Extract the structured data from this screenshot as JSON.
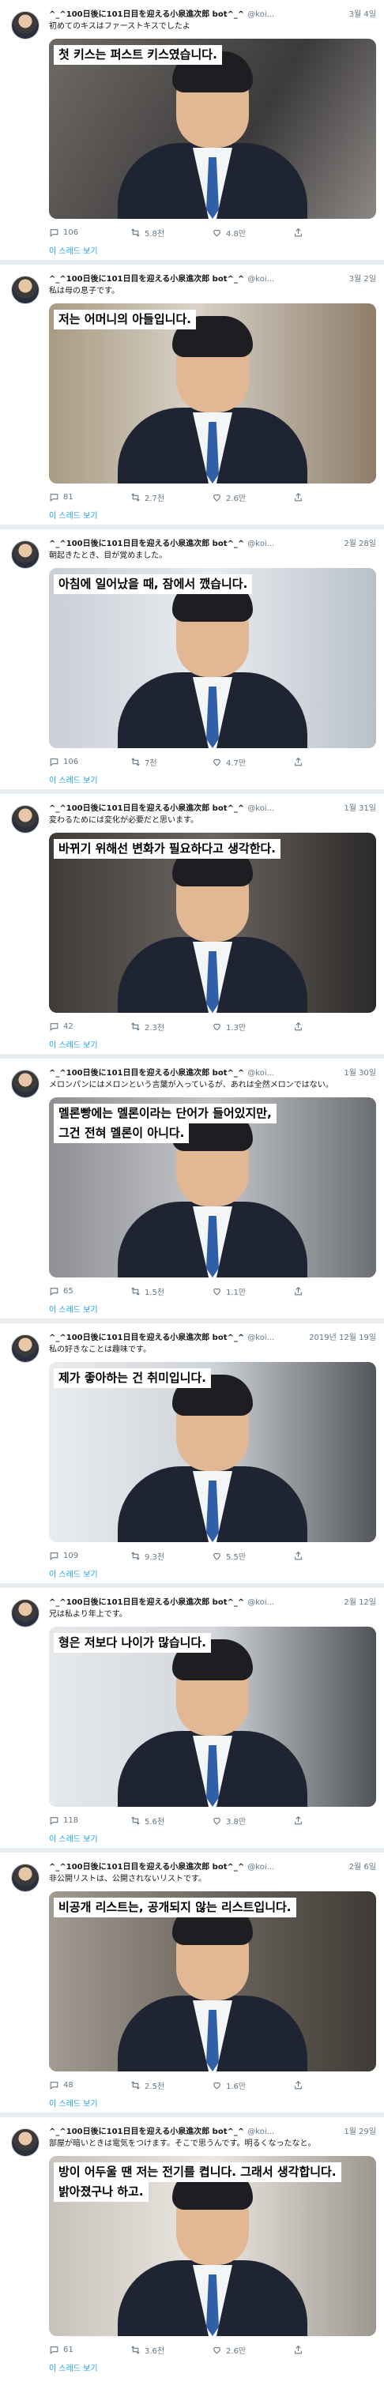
{
  "tweets": [
    {
      "name": "^_^100日後に101日目を迎える小泉進次郎 bot^_^",
      "handle": "@koi...",
      "date": "3월 4일",
      "text": "初めてのキスはファーストキスでしたよ",
      "caption_lines": [
        "첫 키스는 퍼스트 키스였습니다."
      ],
      "replies": "106",
      "retweets": "5.8천",
      "likes": "4.8만",
      "thread": "이 스레드 보기"
    },
    {
      "name": "^_^100日後に101日目を迎える小泉進次郎 bot^_^",
      "handle": "@koi...",
      "date": "3월 2일",
      "text": "私は母の息子です。",
      "caption_lines": [
        "저는 어머니의 아들입니다."
      ],
      "replies": "81",
      "retweets": "2.7천",
      "likes": "2.6만",
      "thread": "이 스레드 보기"
    },
    {
      "name": "^_^100日後に101日目を迎える小泉進次郎 bot^_^",
      "handle": "@koi...",
      "date": "2월 28일",
      "text": "朝起きたとき、目が覚めました。",
      "caption_lines": [
        "아침에 일어났을 때, 잠에서 깼습니다."
      ],
      "replies": "106",
      "retweets": "7천",
      "likes": "4.7만",
      "thread": "이 스레드 보기"
    },
    {
      "name": "^_^100日後に101日目を迎える小泉進次郎 bot^_^",
      "handle": "@koi...",
      "date": "1월 31일",
      "text": "変わるためには変化が必要だと思います。",
      "caption_lines": [
        "바뀌기 위해선 변화가 필요하다고 생각한다."
      ],
      "replies": "42",
      "retweets": "2.3천",
      "likes": "1.3만",
      "thread": "이 스레드 보기"
    },
    {
      "name": "^_^100日後に101日目を迎える小泉進次郎 bot^_^",
      "handle": "@koi...",
      "date": "1월 30일",
      "text": "メロンパンにはメロンという言葉が入っているが、あれは全然メロンではない。",
      "caption_lines": [
        "멜론빵에는 멜론이라는 단어가 들어있지만,",
        "그건 전혀 멜론이 아니다."
      ],
      "replies": "65",
      "retweets": "1.5천",
      "likes": "1.1만",
      "thread": "이 스레드 보기"
    },
    {
      "name": "^_^100日後に101日目を迎える小泉進次郎 bot^_^",
      "handle": "@koi...",
      "date": "2019년 12월 19일",
      "text": "私の好きなことは趣味です。",
      "caption_lines": [
        "제가 좋아하는 건 취미입니다."
      ],
      "replies": "109",
      "retweets": "9.3천",
      "likes": "5.5만",
      "thread": "이 스레드 보기"
    },
    {
      "name": "^_^100日後に101日目を迎える小泉進次郎 bot^_^",
      "handle": "@koi...",
      "date": "2월 12일",
      "text": "兄は私より年上です。",
      "caption_lines": [
        "형은 저보다 나이가 많습니다."
      ],
      "replies": "118",
      "retweets": "5.6천",
      "likes": "3.8만",
      "thread": "이 스레드 보기"
    },
    {
      "name": "^_^100日後に101日目を迎える小泉進次郎 bot^_^",
      "handle": "@koi...",
      "date": "2월 6일",
      "text": "非公開リストは、公開されないリストです。",
      "caption_lines": [
        "비공개 리스트는, 공개되지 않는 리스트입니다."
      ],
      "replies": "48",
      "retweets": "2.5천",
      "likes": "1.6만",
      "thread": "이 스레드 보기"
    },
    {
      "name": "^_^100日後に101日目を迎える小泉進次郎 bot^_^",
      "handle": "@koi...",
      "date": "1월 29일",
      "text": "部屋が暗いときは電気をつけます。そこで思うんです。明るくなったなと。",
      "caption_lines": [
        "방이 어두울 땐 저는 전기를 켭니다. 그래서 생각합니다.",
        "밝아졌구나 하고."
      ],
      "replies": "61",
      "retweets": "3.6천",
      "likes": "2.6만",
      "thread": "이 스레드 보기"
    }
  ],
  "icons": {
    "reply": "reply-icon",
    "retweet": "retweet-icon",
    "like": "heart-icon",
    "share": "share-icon"
  }
}
